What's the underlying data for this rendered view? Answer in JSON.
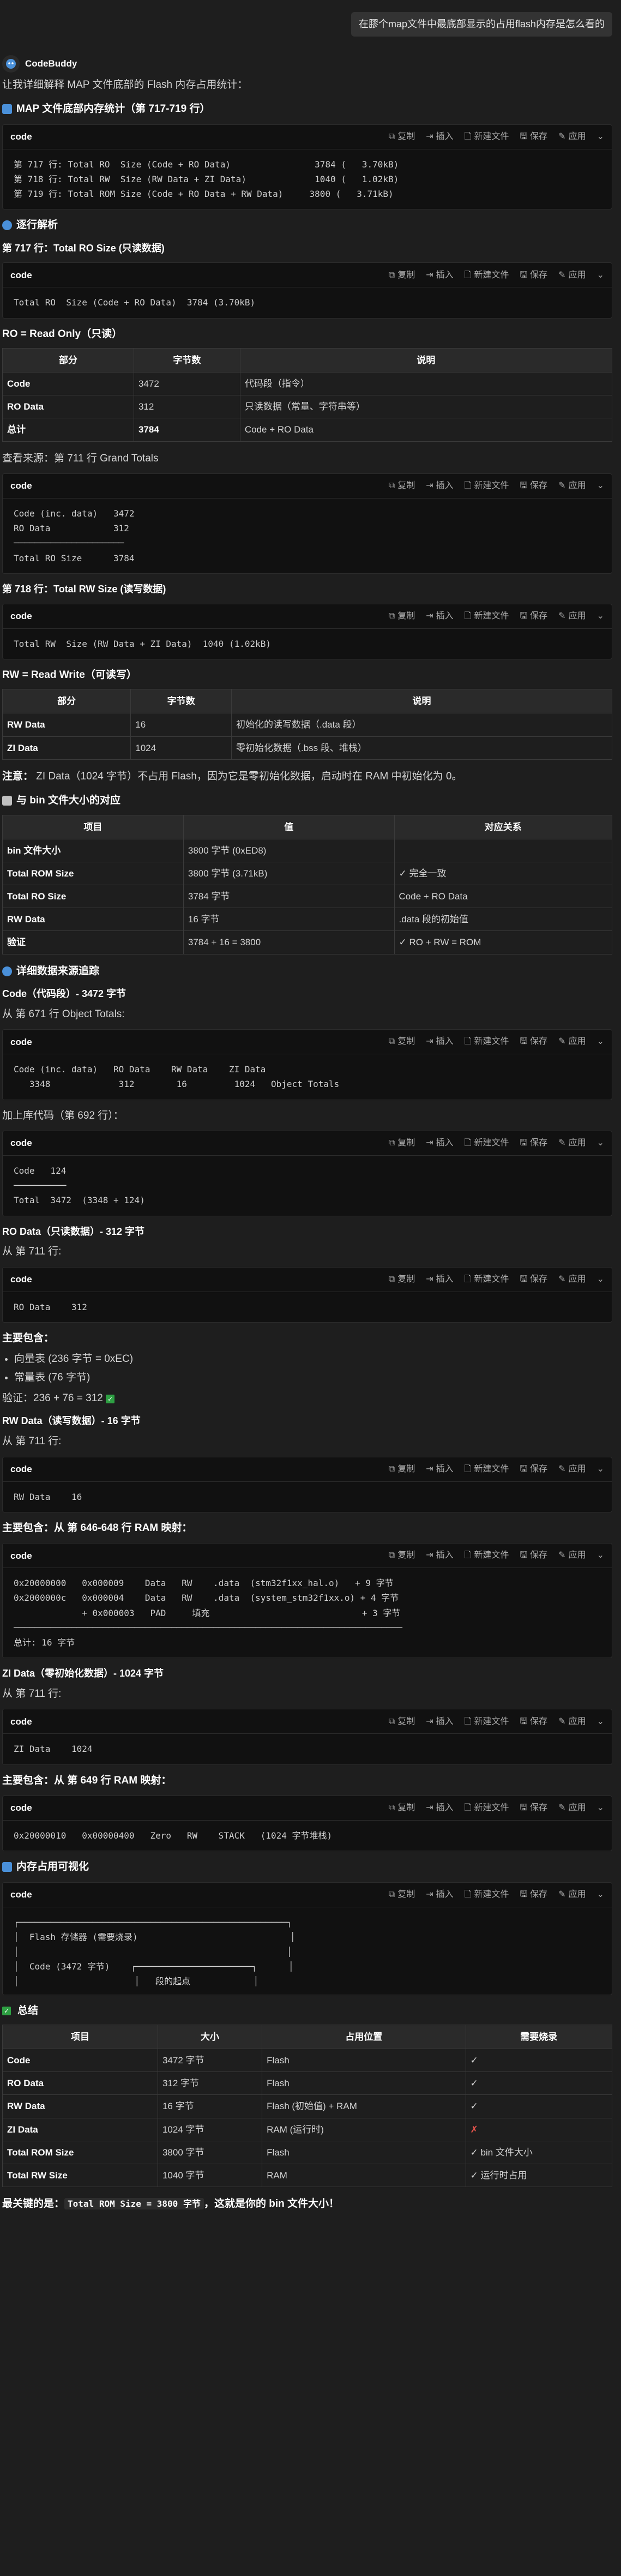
{
  "user_message": "在膠个map文件中最底部显示的占用flash内存是怎么看的",
  "bot_name": "CodeBuddy",
  "intro": "让我详细解释 MAP 文件底部的 Flash 内存占用统计：",
  "code_actions": {
    "copy": "复制",
    "insert": "插入",
    "new_file": "新建文件",
    "save": "保存",
    "apply": "应用",
    "lang": "code"
  },
  "s1_title": "MAP 文件底部内存统计（第 717-719 行）",
  "code1": "第 717 行: Total RO  Size (Code + RO Data)                3784 (   3.70kB)\n第 718 行: Total RW  Size (RW Data + ZI Data)             1040 (   1.02kB)\n第 719 行: Total ROM Size (Code + RO Data + RW Data)     3800 (   3.71kB)",
  "s2_title": "逐行解析",
  "s2_sub1": "第 717 行：Total RO Size (只读数据)",
  "code2": "Total RO  Size (Code + RO Data)  3784 (3.70kB)",
  "ro_def": "RO = Read Only（只读）",
  "t1": {
    "headers": [
      "部分",
      "字节数",
      "说明"
    ],
    "rows": [
      [
        "Code",
        "3472",
        "代码段（指令）"
      ],
      [
        "RO Data",
        "312",
        "只读数据（常量、字符串等）"
      ],
      [
        "总计",
        "3784",
        "Code + RO Data"
      ]
    ]
  },
  "source_note": "查看来源：第 711 行 Grand Totals",
  "code3": "Code (inc. data)   3472\nRO Data            312\n─────────────────────\nTotal RO Size      3784",
  "s2_sub2": "第 718 行：Total RW Size (读写数据)",
  "code4": "Total RW  Size (RW Data + ZI Data)  1040 (1.02kB)",
  "rw_def": "RW = Read Write（可读写）",
  "t2": {
    "headers": [
      "部分",
      "字节数",
      "说明"
    ],
    "rows": [
      [
        "RW Data",
        "16",
        "初始化的读写数据（.data 段）"
      ],
      [
        "ZI Data",
        "1024",
        "零初始化数据（.bss 段、堆栈）"
      ]
    ]
  },
  "note_label": "注意：",
  "note_text": "ZI Data（1024 字节）不占用 Flash，因为它是零初始化数据，启动时在 RAM 中初始化为 0。",
  "s3_title": "与 bin 文件大小的对应",
  "t3": {
    "headers": [
      "项目",
      "值",
      "对应关系"
    ],
    "rows": [
      [
        "bin 文件大小",
        "3800 字节 (0xED8)",
        ""
      ],
      [
        "Total ROM Size",
        "3800 字节 (3.71kB)",
        "✓ 完全一致"
      ],
      [
        "Total RO Size",
        "3784 字节",
        "Code + RO Data"
      ],
      [
        "RW Data",
        "16 字节",
        ".data 段的初始值"
      ],
      [
        "验证",
        "3784 + 16 = 3800",
        "✓ RO + RW = ROM"
      ]
    ]
  },
  "s4_title": "详细数据来源追踪",
  "s4_code_title": "Code（代码段）- 3472 字节",
  "s4_code_src": "从 第 671 行 Object Totals:",
  "code5": "Code (inc. data)   RO Data    RW Data    ZI Data\n   3348             312        16         1024   Object Totals",
  "s4_lib": "加上库代码（第 692 行）：",
  "code6": "Code   124\n──────────\nTotal  3472  (3348 + 124)",
  "s4_ro_title": "RO Data（只读数据）- 312 字节",
  "s4_ro_src": "从 第 711 行:",
  "code7": "RO Data    312",
  "s4_ro_inc": "主要包含：",
  "s4_ro_items": [
    "向量表 (236 字节 = 0xEC)",
    "常量表 (76 字节)"
  ],
  "s4_ro_verify": "验证：236 + 76 = 312",
  "s4_rw_title": "RW Data（读写数据）- 16 字节",
  "s4_rw_src": "从 第 711 行:",
  "code8": "RW Data    16",
  "s4_rw_inc": "主要包含：从 第 646-648 行 RAM 映射：",
  "code9": "0x20000000   0x000009    Data   RW    .data  (stm32f1xx_hal.o)   + 9 字节\n0x2000000c   0x000004    Data   RW    .data  (system_stm32f1xx.o) + 4 字节\n             + 0x000003   PAD     填充                             + 3 字节\n──────────────────────────────────────────────────────────────────────────\n总计: 16 字节",
  "s4_zi_title": "ZI Data（零初始化数据）- 1024 字节",
  "s4_zi_src": "从 第 711 行:",
  "code10": "ZI Data    1024",
  "s4_zi_inc": "主要包含：从 第 649 行 RAM 映射：",
  "code11": "0x20000010   0x00000400   Zero   RW    STACK   (1024 字节堆栈)",
  "s5_title": "内存占用可视化",
  "code12": "┌───────────────────────────────────────────────────┐\n│  Flash 存储器 (需要烧录)                             │\n│                                                   │\n│  Code (3472 字节)    ┌──────────────────────┐      │\n│                      │   段的起点            │",
  "s6_title": "总结",
  "t4": {
    "headers": [
      "项目",
      "大小",
      "占用位置",
      "需要烧录"
    ],
    "rows": [
      [
        "Code",
        "3472 字节",
        "Flash",
        "✓"
      ],
      [
        "RO Data",
        "312 字节",
        "Flash",
        "✓"
      ],
      [
        "RW Data",
        "16 字节",
        "Flash (初始值) + RAM",
        "✓"
      ],
      [
        "ZI Data",
        "1024 字节",
        "RAM (运行时)",
        "✗"
      ],
      [
        "Total ROM Size",
        "3800 字节",
        "Flash",
        "✓ bin 文件大小"
      ],
      [
        "Total RW Size",
        "1040 字节",
        "RAM",
        "✓ 运行时占用"
      ]
    ]
  },
  "final_prefix": "最关键的是：",
  "final_code": "Total ROM Size = 3800 字节",
  "final_suffix": "，这就是你的 bin 文件大小！",
  "colors": {
    "accent_blue": "#4a90d9",
    "check_green": "#2ea043",
    "cross_red": "#e5534b"
  }
}
